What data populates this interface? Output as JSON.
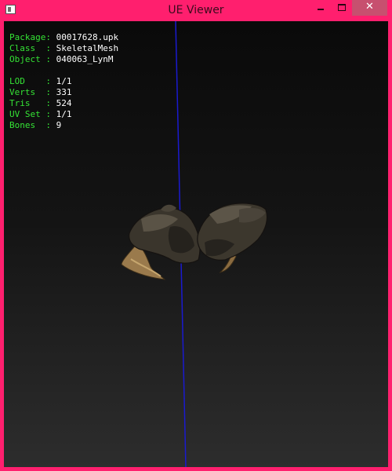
{
  "window": {
    "title": "UE Viewer",
    "accent": "#ff1f6e"
  },
  "controls": {
    "minimize_icon": "minimize-icon",
    "maximize_icon": "maximize-icon",
    "close_glyph": "✕"
  },
  "info": {
    "package_key": "Package:",
    "package_val": "00017628.upk",
    "class_key": "Class  :",
    "class_val": "SkeletalMesh",
    "object_key": "Object :",
    "object_val": "040063_LynM",
    "lod_key": "LOD    :",
    "lod_val": "1/1",
    "verts_key": "Verts  :",
    "verts_val": "331",
    "tris_key": "Tris   :",
    "tris_val": "524",
    "uvset_key": "UV Set :",
    "uvset_val": "1/1",
    "bones_key": "Bones  :",
    "bones_val": "9"
  },
  "colors": {
    "label": "#35e335",
    "value": "#ffffff",
    "axis": "#1a1ad0"
  }
}
